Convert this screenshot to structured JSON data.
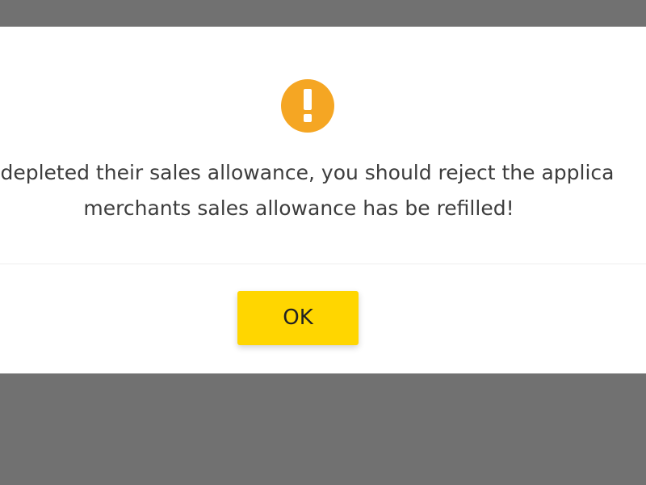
{
  "dialog": {
    "icon": "exclamation-circle-icon",
    "icon_color": "#f5a623",
    "message_line_1": "s depleted their sales allowance, you should reject the applica",
    "message_line_2": "merchants sales allowance has be refilled!",
    "ok_label": "OK",
    "ok_color": "#ffd600"
  }
}
